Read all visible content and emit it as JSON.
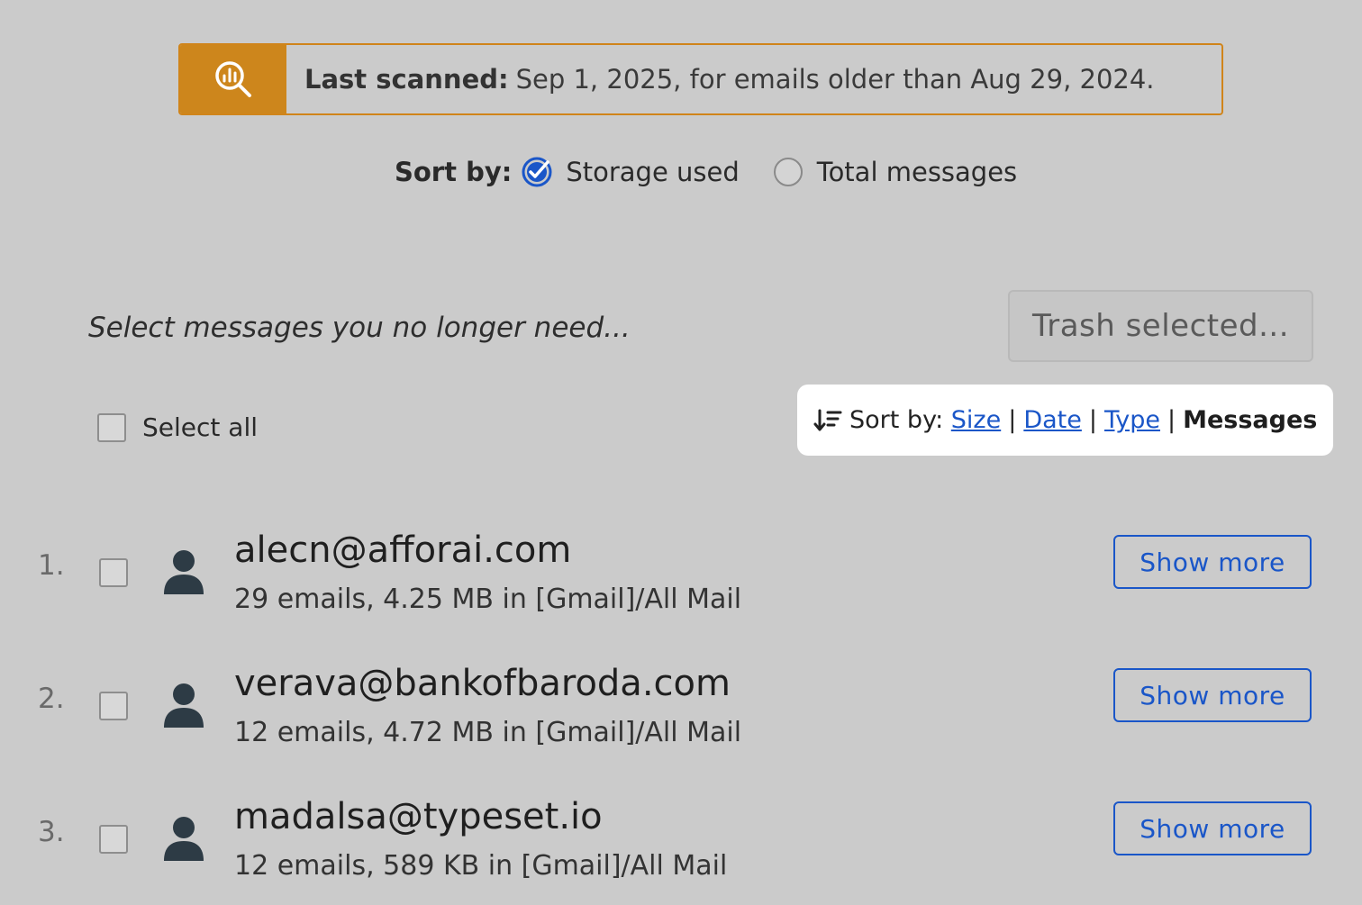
{
  "banner": {
    "label": "Last scanned:",
    "text": "Sep 1, 2025, for emails older than Aug 29, 2024.",
    "icon": "search-analytics-icon",
    "color": "#cd861c"
  },
  "top_sort": {
    "label": "Sort by:",
    "options": [
      {
        "label": "Storage used",
        "selected": true
      },
      {
        "label": "Total messages",
        "selected": false
      }
    ]
  },
  "instructions": "Select messages you no longer need...",
  "trash_button": "Trash selected...",
  "select_all": "Select all",
  "list_sort": {
    "label": "Sort by:",
    "options": [
      "Size",
      "Date",
      "Type",
      "Messages"
    ],
    "active": "Messages",
    "separator": "|"
  },
  "senders": [
    {
      "num": "1.",
      "email": "alecn@afforai.com",
      "meta": "29 emails, 4.25 MB in [Gmail]/All Mail",
      "button": "Show more"
    },
    {
      "num": "2.",
      "email": "verava@bankofbaroda.com",
      "meta": "12 emails, 4.72 MB in [Gmail]/All Mail",
      "button": "Show more"
    },
    {
      "num": "3.",
      "email": "madalsa@typeset.io",
      "meta": "12 emails, 589 KB in [Gmail]/All Mail",
      "button": "Show more"
    }
  ],
  "colors": {
    "accent": "#cd861c",
    "link": "#1a56c8",
    "background": "#cbcbcb"
  }
}
